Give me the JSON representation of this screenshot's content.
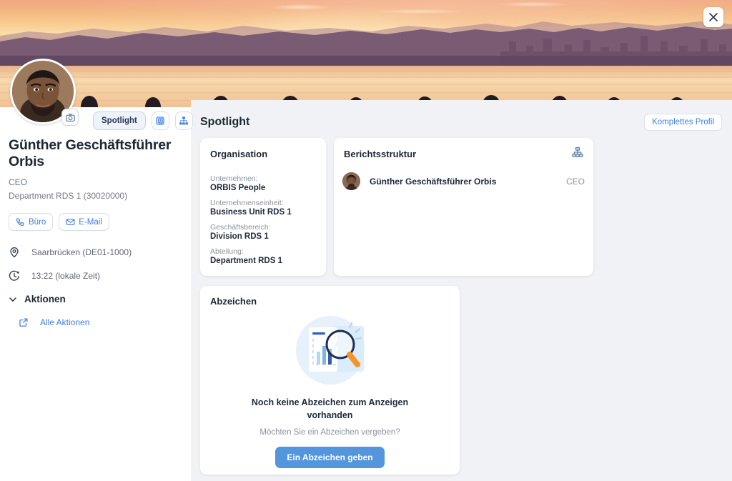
{
  "window": {
    "close_label": "×",
    "close_icon": "close-icon"
  },
  "banner": {
    "alt": "sunset-over-water-banner",
    "sky_top": "#f0a882",
    "sky_glow": "#fadfa8",
    "mountain": "#6b5168",
    "water": "#f2c79a"
  },
  "sidebar": {
    "avatar_icon": "user-avatar",
    "camera_icon": "camera-icon",
    "tabs": [
      {
        "label": "Spotlight",
        "name": "tab-spotlight",
        "active": true
      },
      {
        "label": "",
        "name": "tab-profile-card",
        "icon": "id-card-icon"
      },
      {
        "label": "",
        "name": "tab-org-chart",
        "icon": "org-chart-icon"
      }
    ],
    "person": {
      "name": "Günther Geschäftsführer Orbis",
      "role": "CEO",
      "department": "Department RDS 1 (30020000)"
    },
    "contact_buttons": [
      {
        "label": "Büro",
        "icon": "phone-icon",
        "name": "office-phone-button"
      },
      {
        "label": "E-Mail",
        "icon": "envelope-icon",
        "name": "email-button"
      }
    ],
    "meta": [
      {
        "icon": "location-pin-icon",
        "text": "Saarbrücken (DE01-1000)"
      },
      {
        "icon": "clock-icon",
        "text": "13:22 (lokale Zeit)"
      }
    ],
    "actions_section": {
      "title": "Aktionen",
      "chevron_icon": "chevron-down-icon",
      "items": [
        {
          "label": "Alle Aktionen",
          "icon": "external-link-icon"
        }
      ]
    }
  },
  "main": {
    "title": "Spotlight",
    "full_profile_button": "Komplettes Profil",
    "organisation_card": {
      "title": "Organisation",
      "rows": [
        {
          "label": "Unternehmen:",
          "value": "ORBIS People"
        },
        {
          "label": "Unternehmenseinheit:",
          "value": "Business Unit RDS 1"
        },
        {
          "label": "Geschäftsbereich:",
          "value": "Division RDS 1"
        },
        {
          "label": "Abteilung:",
          "value": "Department RDS 1"
        }
      ]
    },
    "reporting_card": {
      "title": "Berichtsstruktur",
      "org_icon": "org-chart-icon",
      "rows": [
        {
          "name": "Günther Geschäftsführer Orbis",
          "title": "CEO",
          "avatar": "user-avatar"
        }
      ]
    },
    "badges_card": {
      "title": "Abzeichen",
      "illustration": "magnifier-chart-illustration",
      "empty_heading": "Noch keine Abzeichen zum Anzeigen vorhanden",
      "empty_subtext": "Möchten Sie ein Abzeichen vergeben?",
      "cta_label": "Ein Abzeichen geben"
    }
  },
  "colors": {
    "accent": "#3f7fe0",
    "cta": "#5396dd",
    "text": "#1d2733",
    "muted": "#8a939f",
    "bg": "#f1f2f5"
  }
}
